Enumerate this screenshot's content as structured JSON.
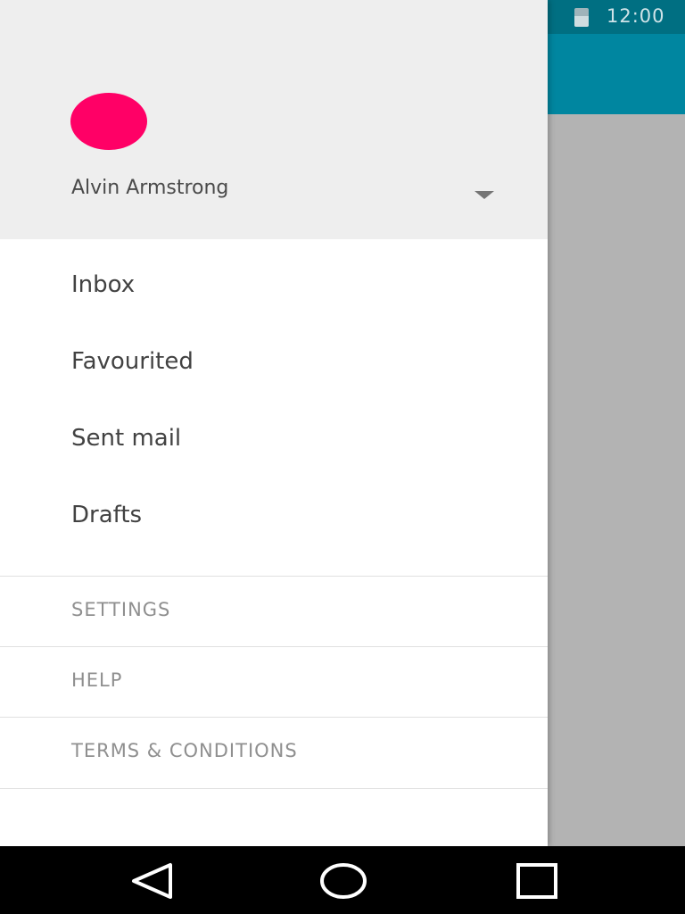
{
  "status_bar": {
    "time": "12:00",
    "battery_icon": "battery-icon",
    "background": "#006f82"
  },
  "app_bar": {
    "background": "#0086a0"
  },
  "drawer": {
    "header": {
      "account_name": "Alvin Armstrong",
      "avatar_color": "#ff0066",
      "dropdown_icon": "arrow-drop-down-icon"
    },
    "items": [
      {
        "label": "Inbox"
      },
      {
        "label": "Favourited"
      },
      {
        "label": "Sent mail"
      },
      {
        "label": "Drafts"
      }
    ],
    "footer_items": [
      {
        "label": "SETTINGS"
      },
      {
        "label": "HELP"
      },
      {
        "label": "TERMS & CONDITIONS"
      }
    ]
  },
  "nav_bar": {
    "back_icon": "back-icon",
    "home_icon": "home-icon",
    "recents_icon": "recents-icon"
  }
}
